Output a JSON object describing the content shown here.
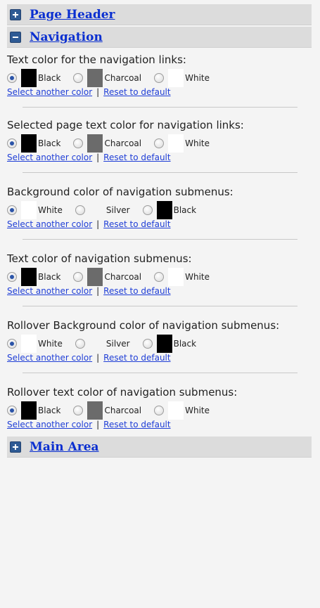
{
  "sections": {
    "page_header": "Page Header",
    "navigation": "Navigation",
    "main_area": "Main Area"
  },
  "links": {
    "select_color": "Select another color",
    "separator": "|",
    "reset": "Reset to default"
  },
  "groups": [
    {
      "label": "Text color for the navigation links:",
      "options": [
        "Black",
        "Charcoal",
        "White"
      ],
      "selected": "Black"
    },
    {
      "label": "Selected page text color for navigation links:",
      "options": [
        "Black",
        "Charcoal",
        "White"
      ],
      "selected": "Black"
    },
    {
      "label": "Background color of navigation submenus:",
      "options": [
        "White",
        "Silver",
        "Black"
      ],
      "selected": "White"
    },
    {
      "label": "Text color of navigation submenus:",
      "options": [
        "Black",
        "Charcoal",
        "White"
      ],
      "selected": "Black"
    },
    {
      "label": "Rollover Background color of navigation submenus:",
      "options": [
        "White",
        "Silver",
        "Black"
      ],
      "selected": "White"
    },
    {
      "label": "Rollover text color of navigation submenus:",
      "options": [
        "Black",
        "Charcoal",
        "White"
      ],
      "selected": "Black"
    }
  ],
  "swatch_colors": {
    "Black": "#000000",
    "Charcoal": "#6b6b6b",
    "White": "#ffffff",
    "Silver": "#f4f4f4"
  },
  "accent": {
    "link": "#1f3ed6",
    "header_bg": "#dcdcdc",
    "toggle": "#2e5a94"
  }
}
